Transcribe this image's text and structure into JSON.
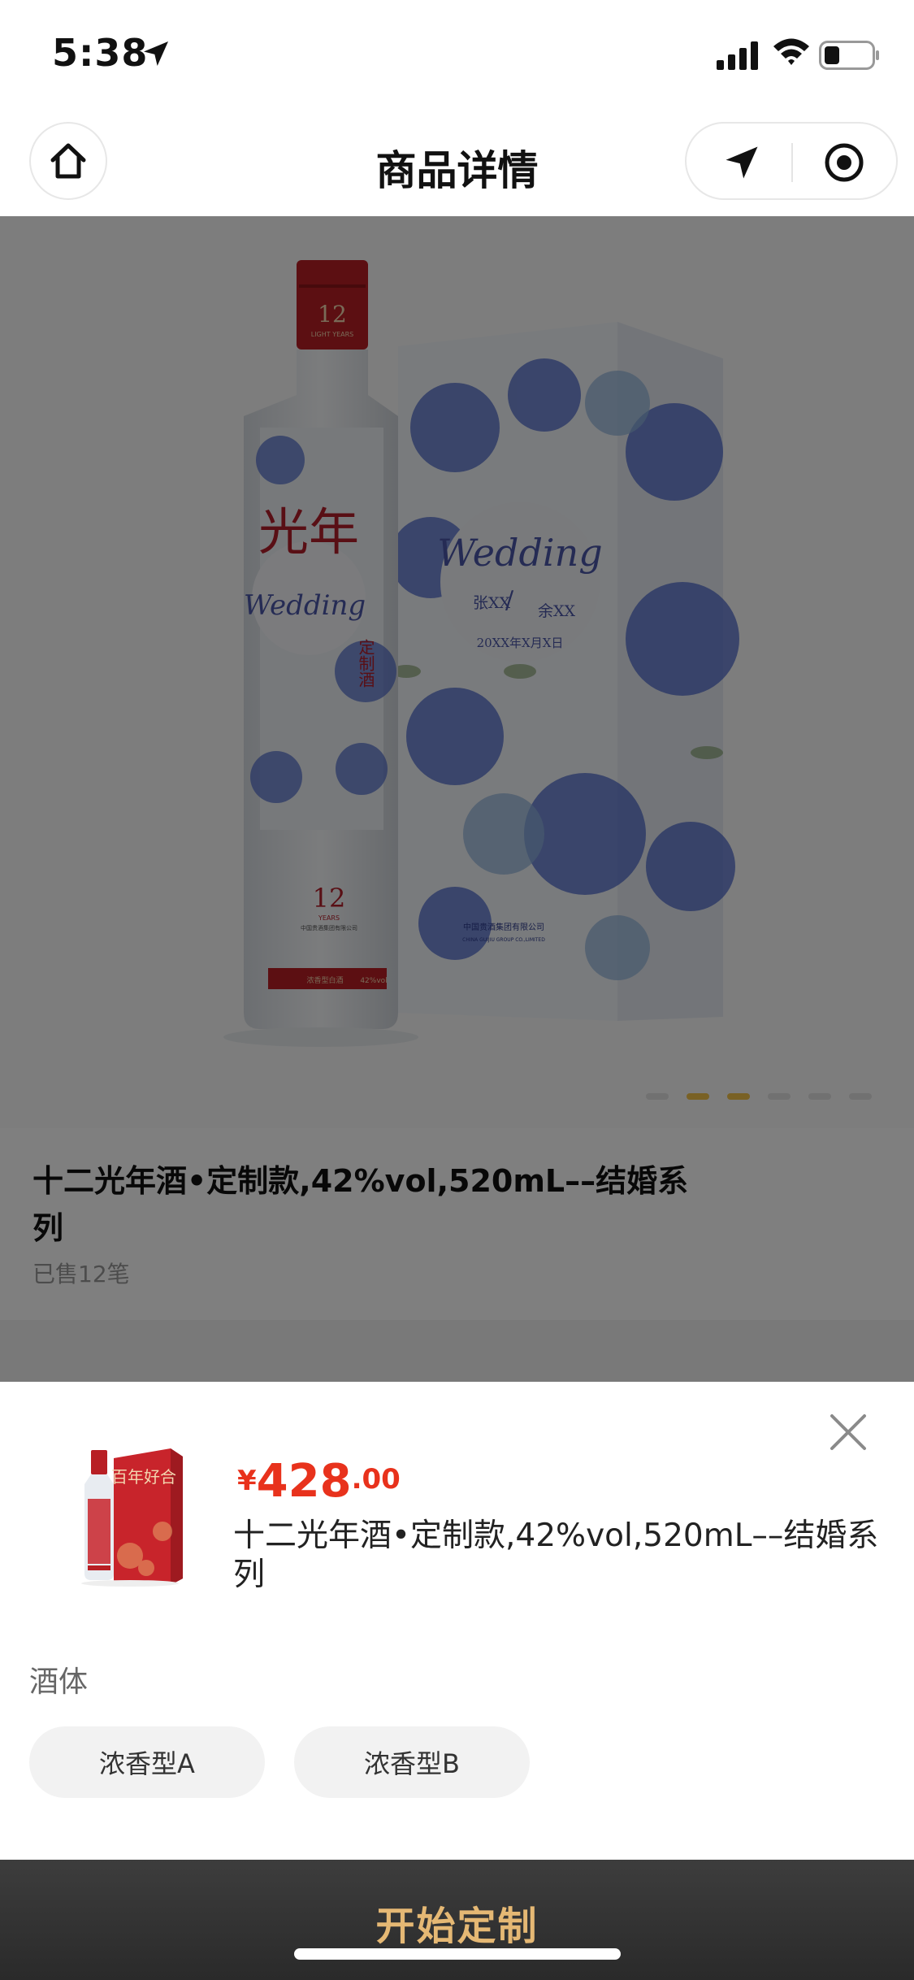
{
  "status_bar": {
    "time": "5:38"
  },
  "nav": {
    "title": "商品详情"
  },
  "gallery": {
    "bottle_neck_number": "12",
    "bottle_neck_text": "LIGHT YEARS",
    "bottle_brand": "光年",
    "bottle_sub": "定制酒",
    "bottle_script": "Wedding",
    "bottle_number": "12",
    "bottle_years": "YEARS",
    "bottle_company": "中国贵酒集团有限公司",
    "bottle_band_left": "浓香型白酒",
    "bottle_band_right": "42%vol",
    "box_script": "Wedding",
    "box_name_left": "张XX",
    "box_name_right": "余XX",
    "box_date": "20XX年X月X日",
    "box_company": "中国贵酒集团有限公司",
    "box_company_en": "CHINA GUIJIU GROUP CO.,LIMITED",
    "dots_total": 6,
    "dots_active": [
      2,
      3
    ]
  },
  "product": {
    "title": "十二光年酒•定制款,42%vol,520mL––结婚系列",
    "sold": "已售12笔"
  },
  "sheet": {
    "price_currency": "¥",
    "price_int": "428",
    "price_dec": ".00",
    "title": "十二光年酒•定制款,42%vol,520mL––结婚系列",
    "thumb_text": "百年好合",
    "spec_label": "酒体",
    "options": [
      "浓香型A",
      "浓香型B"
    ],
    "cta": "开始定制"
  },
  "colors": {
    "price": "#e8321c",
    "cta_text": "#e5b874",
    "cta_bg": "#2f2f2f",
    "dot_active": "#f2c24a"
  }
}
